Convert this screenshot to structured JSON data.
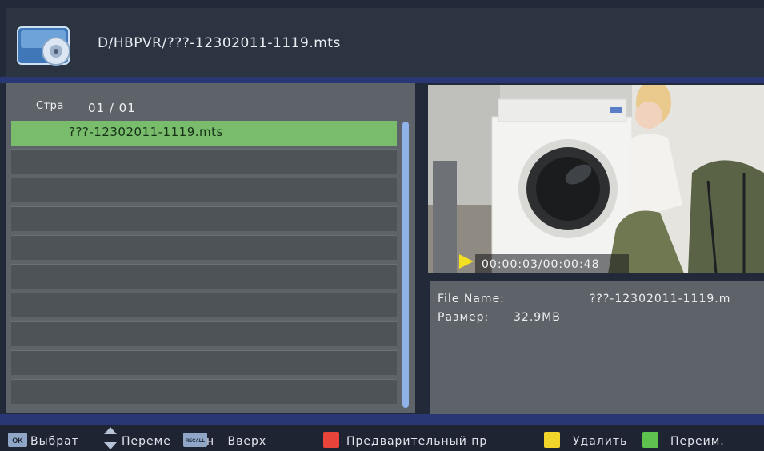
{
  "header": {
    "path": "D/HBPVR/???-12302011-1119.mts",
    "icon": "disc-folder-icon"
  },
  "list": {
    "page_label": "Стра",
    "page_value": "01 / 01",
    "items": [
      "???-12302011-1119.mts"
    ]
  },
  "preview": {
    "time": "00:00:03/00:00:48"
  },
  "info": {
    "file_name_label": "File Name:",
    "file_name_value": "???-12302011-1119.m",
    "size_label": "Размер:",
    "size_value": "32.9MB"
  },
  "footer": {
    "ok_key": "OK",
    "select": "Выбрат",
    "move": "Переме",
    "recall_key": "RECALL",
    "recall": "н   Вверх",
    "preview": "Предварительный пр",
    "delete": "Удалить",
    "rename": "Переим.",
    "colors": {
      "red": "#e8443a",
      "yellow": "#f2d42a",
      "green": "#5ec24f"
    }
  }
}
